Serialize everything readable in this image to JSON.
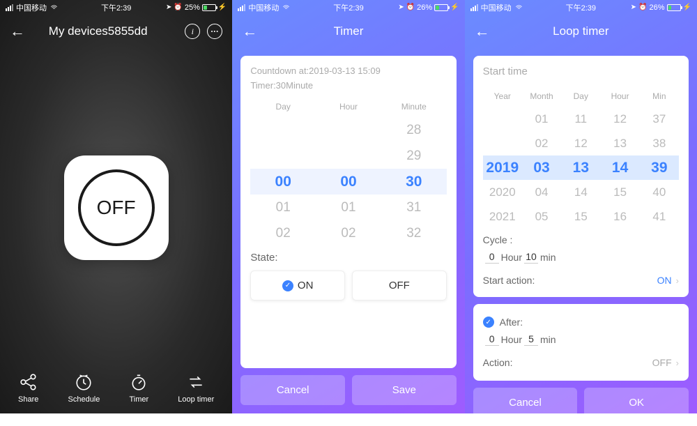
{
  "status": {
    "carrier": "中国移动",
    "time": "下午2:39",
    "battery1": "25%",
    "battery2": "26%",
    "battery3": "26%"
  },
  "screen1": {
    "title": "My devices5855dd",
    "main_button": "OFF",
    "tabs": [
      "Share",
      "Schedule",
      "Timer",
      "Loop timer"
    ]
  },
  "screen2": {
    "title": "Timer",
    "countdown": "Countdown at:2019-03-13 15:09",
    "timer_line": "Timer:30Minute",
    "cols": [
      "Day",
      "Hour",
      "Minute"
    ],
    "picker": {
      "day": [
        "",
        "",
        "00",
        "01",
        "02"
      ],
      "hour": [
        "",
        "",
        "00",
        "01",
        "02"
      ],
      "minute": [
        "28",
        "29",
        "30",
        "31",
        "32"
      ]
    },
    "sel_idx": 2,
    "state_label": "State:",
    "on": "ON",
    "off": "OFF",
    "cancel": "Cancel",
    "save": "Save"
  },
  "screen3": {
    "title": "Loop timer",
    "start_time": "Start time",
    "cols": [
      "Year",
      "Month",
      "Day",
      "Hour",
      "Min"
    ],
    "picker": {
      "year": [
        "",
        "01",
        "02",
        "03",
        "04",
        "05"
      ],
      "year_actual": [
        "",
        "",
        "2019",
        "2020",
        "2021"
      ],
      "col1": [
        "",
        "",
        "2019",
        "2020",
        "2021"
      ],
      "col2": [
        "01",
        "02",
        "03",
        "04",
        "05"
      ],
      "col3": [
        "11",
        "12",
        "13",
        "14",
        "15"
      ],
      "col4": [
        "12",
        "13",
        "14",
        "15",
        "16"
      ],
      "col5": [
        "37",
        "38",
        "39",
        "40",
        "41"
      ]
    },
    "sel_idx": 2,
    "cycle_label": "Cycle :",
    "cycle_h": "0",
    "cycle_h_unit": "Hour",
    "cycle_m": "10",
    "cycle_m_unit": "min",
    "start_action": "Start action:",
    "start_action_val": "ON",
    "after": "After:",
    "after_h": "0",
    "after_h_unit": "Hour",
    "after_m": "5",
    "after_m_unit": "min",
    "action": "Action:",
    "action_val": "OFF",
    "cancel": "Cancel",
    "ok": "OK"
  }
}
